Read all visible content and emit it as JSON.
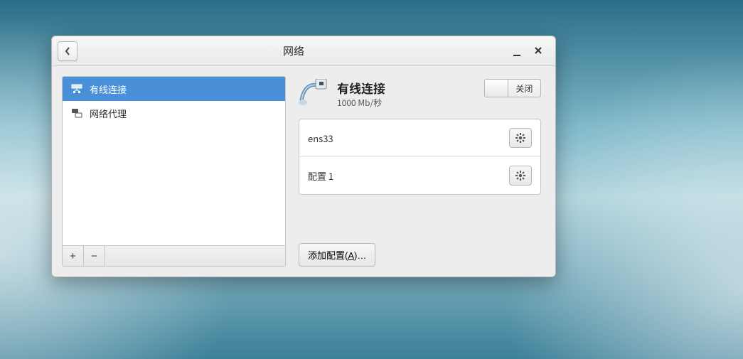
{
  "window": {
    "title": "网络"
  },
  "sidebar": {
    "items": [
      {
        "label": "有线连接",
        "selected": true
      },
      {
        "label": "网络代理",
        "selected": false
      }
    ]
  },
  "detail": {
    "title": "有线连接",
    "subtitle": "1000 Mb/秒",
    "switch_state": "off",
    "switch_label": "关闭",
    "connections": [
      {
        "name": "ens33"
      },
      {
        "name": "配置 1"
      }
    ],
    "add_profile_label_pre": "添加配置(",
    "add_profile_accel": "A",
    "add_profile_label_post": ")…"
  }
}
